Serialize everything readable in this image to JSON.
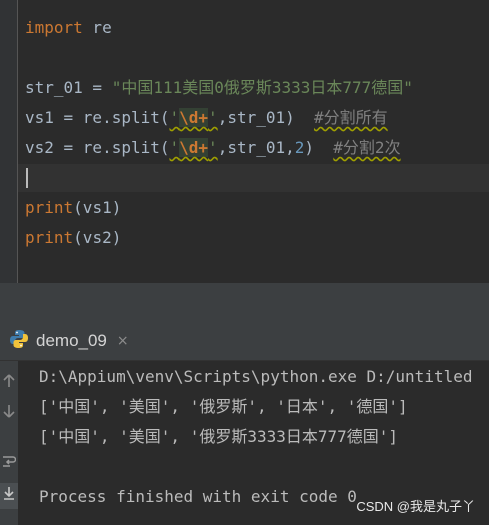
{
  "editor": {
    "line1": {
      "kw": "import",
      "rest": " re"
    },
    "line3": {
      "pre": "str_01 = ",
      "str": "\"中国111美国0俄罗斯3333日本777德国\""
    },
    "line4": {
      "pre": "vs1 = re.split(",
      "q1": "'",
      "esc": "\\d+",
      "q2": "'",
      "post": ",str_01)  ",
      "cmt": "#分割所有"
    },
    "line5": {
      "pre": "vs2 = re.split(",
      "q1": "'",
      "esc": "\\d+",
      "q2": "'",
      "mid": ",str_01,",
      "num": "2",
      "post": ")  ",
      "cmt": "#分割2次"
    },
    "line7": {
      "kw": "print",
      "rest": "(vs1)"
    },
    "line8": {
      "kw": "print",
      "rest": "(vs2)"
    }
  },
  "run": {
    "tab_label": "demo_09",
    "close": "×",
    "output": [
      "D:\\Appium\\venv\\Scripts\\python.exe D:/untitled",
      "['中国', '美国', '俄罗斯', '日本', '德国']",
      "['中国', '美国', '俄罗斯3333日本777德国']",
      "",
      "Process finished with exit code 0"
    ]
  },
  "watermark": "CSDN @我是丸子丫"
}
